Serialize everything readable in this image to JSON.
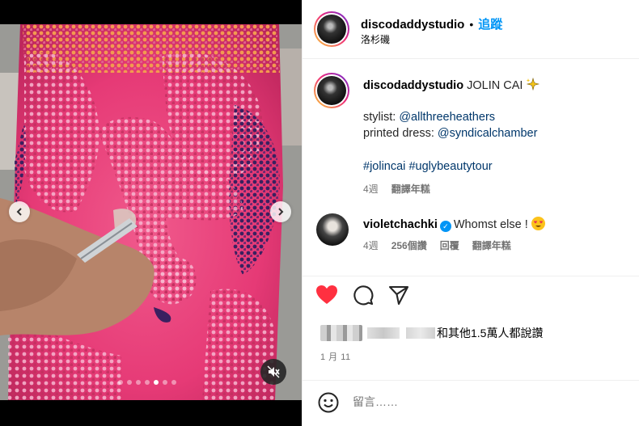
{
  "post": {
    "account": "discodaddystudio",
    "separator": "•",
    "follow_label": "追蹤",
    "location": "洛杉磯"
  },
  "caption": {
    "username": "discodaddystudio",
    "title": "JOLIN CAI",
    "stylist_label": "stylist:",
    "stylist_handle": "@allthreeheathers",
    "dress_label": "printed dress:",
    "dress_handle": "@syndicalchamber",
    "hashtag_1": "#jolincai",
    "hashtag_2": "#uglybeautytour",
    "time": "4週",
    "translate": "翻譯年糕"
  },
  "comment": {
    "username": "violetchachki",
    "text": "Whomst else !",
    "time": "4週",
    "likes": "256個讚",
    "reply": "回覆",
    "translate": "翻譯年糕"
  },
  "likes": {
    "text": "和其他1.5萬人都說讚"
  },
  "date": "1 月 11",
  "comment_input": {
    "placeholder": "留言……"
  },
  "carousel": {
    "dot_count": 7,
    "active_index": 4
  },
  "icons": {
    "heart": "heart-icon",
    "comment": "comment-icon",
    "share": "share-icon",
    "emoji": "emoji-icon",
    "mute": "mute-icon",
    "verified": "verified-icon",
    "sparkle": "sparkle-emoji"
  },
  "colors": {
    "link": "#00376b",
    "follow": "#0095f6",
    "liked": "#ff3040"
  }
}
